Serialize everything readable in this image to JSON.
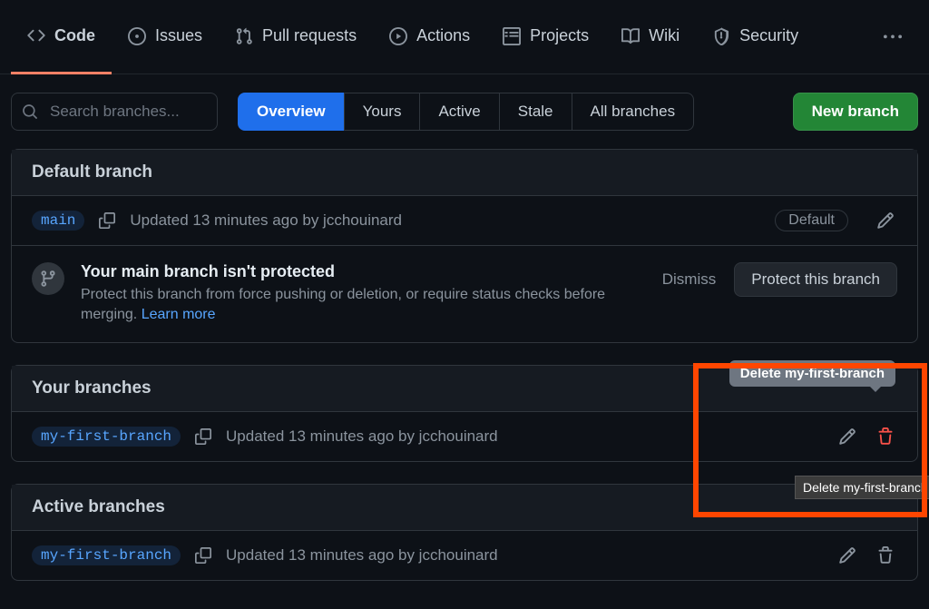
{
  "nav": {
    "code": "Code",
    "issues": "Issues",
    "pulls": "Pull requests",
    "actions": "Actions",
    "projects": "Projects",
    "wiki": "Wiki",
    "security": "Security"
  },
  "search": {
    "placeholder": "Search branches..."
  },
  "filters": {
    "overview": "Overview",
    "yours": "Yours",
    "active": "Active",
    "stale": "Stale",
    "all": "All branches"
  },
  "new_branch_label": "New branch",
  "default_section": {
    "title": "Default branch",
    "branch": "main",
    "updated": "Updated 13 minutes ago by jcchouinard",
    "badge": "Default"
  },
  "notice": {
    "title": "Your main branch isn't protected",
    "desc": "Protect this branch from force pushing or deletion, or require status checks before merging. ",
    "learn": "Learn more",
    "dismiss": "Dismiss",
    "protect": "Protect this branch"
  },
  "your_section": {
    "title": "Your branches",
    "branch": "my-first-branch",
    "updated": "Updated 13 minutes ago by jcchouinard",
    "tooltip": "Delete my-first-branch",
    "os_tooltip": "Delete my-first-branch"
  },
  "active_section": {
    "title": "Active branches",
    "branch": "my-first-branch",
    "updated": "Updated 13 minutes ago by jcchouinard"
  }
}
